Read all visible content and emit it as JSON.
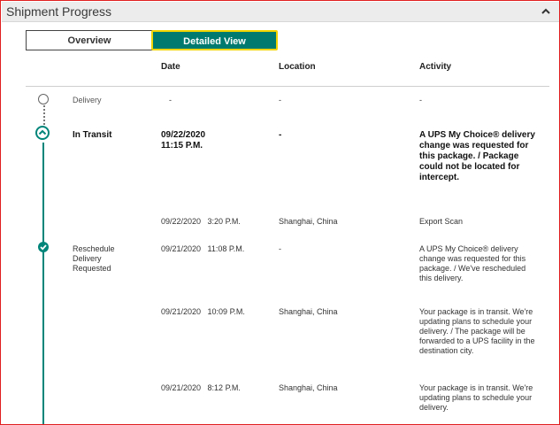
{
  "header": {
    "title": "Shipment Progress"
  },
  "tabs": {
    "overview": "Overview",
    "detailed": "Detailed View"
  },
  "columns": {
    "date": "Date",
    "location": "Location",
    "activity": "Activity"
  },
  "rows": [
    {
      "status": "Delivery",
      "date": "-",
      "location": "-",
      "activity": "-"
    },
    {
      "status": "In Transit",
      "date": "09/22/2020\n11:15 P.M.",
      "location": "-",
      "activity": "A UPS My Choice® delivery change was requested for this package. / Package could not be located for intercept."
    },
    {
      "status": "",
      "date": "09/22/2020   3:20 P.M.",
      "location": "Shanghai, China",
      "activity": "Export Scan"
    },
    {
      "status": "Reschedule Delivery Requested",
      "date": "09/21/2020   11:08 P.M.",
      "location": "-",
      "activity": "A UPS My Choice® delivery change was requested for this package. / We've rescheduled this delivery."
    },
    {
      "status": "",
      "date": "09/21/2020   10:09 P.M.",
      "location": "Shanghai, China",
      "activity": "Your package is in transit. We're updating plans to schedule your delivery. / The package will be forwarded to a UPS facility in the destination city."
    },
    {
      "status": "",
      "date": "09/21/2020   8:12 P.M.",
      "location": "Shanghai, China",
      "activity": "Your package is in transit. We're updating plans to schedule your delivery."
    }
  ],
  "icons": {
    "collapse": "chevron-up-icon",
    "transit": "chevron-up-circle-icon",
    "check": "check-circle-icon"
  },
  "colors": {
    "accent": "#007a6e",
    "highlight": "#f2d500"
  }
}
